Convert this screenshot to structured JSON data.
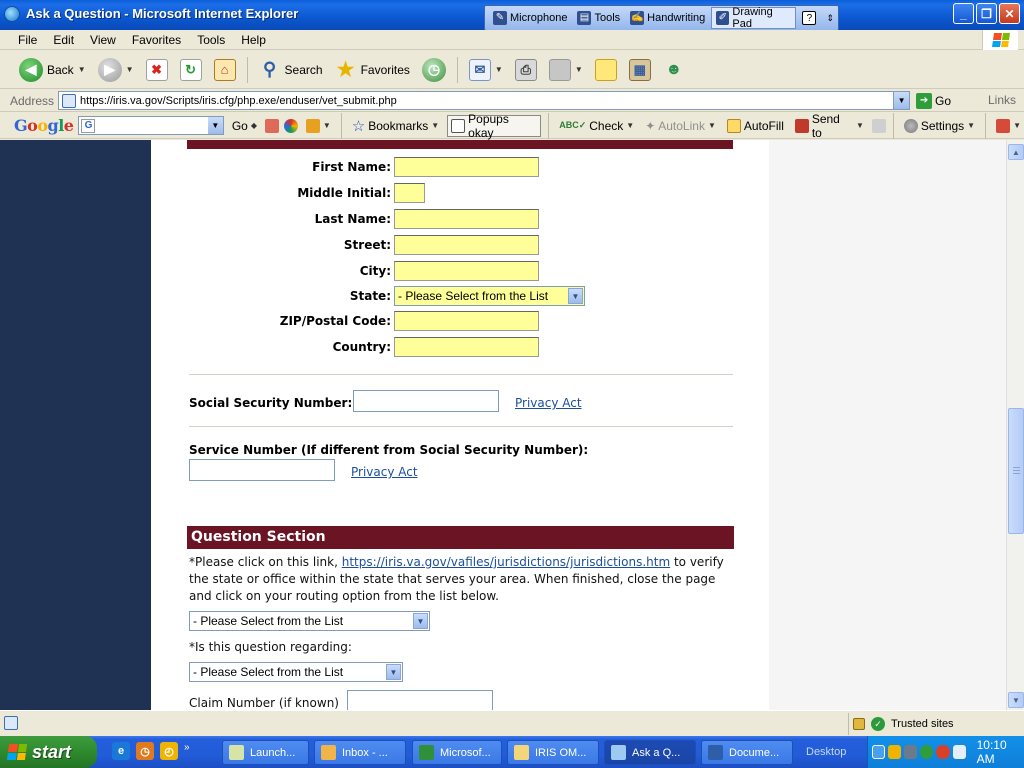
{
  "window": {
    "title": "Ask a Question - Microsoft Internet Explorer",
    "controls": {
      "minimize": "_",
      "maximize": "❐",
      "close": "✕"
    }
  },
  "language_bar": {
    "items": [
      "Microphone",
      "Tools",
      "Handwriting",
      "Drawing Pad"
    ],
    "help": "?"
  },
  "menu": [
    "File",
    "Edit",
    "View",
    "Favorites",
    "Tools",
    "Help"
  ],
  "toolbar": {
    "back": "Back",
    "search": "Search",
    "favorites": "Favorites"
  },
  "address": {
    "label": "Address",
    "url": "https://iris.va.gov/Scripts/iris.cfg/php.exe/enduser/vet_submit.php",
    "go": "Go",
    "links": "Links"
  },
  "google_toolbar": {
    "logo": "Google",
    "go": "Go",
    "bookmarks": "Bookmarks",
    "popups": "Popups okay",
    "check": "Check",
    "autolink": "AutoLink",
    "autofill": "AutoFill",
    "send_to": "Send to",
    "settings": "Settings"
  },
  "form": {
    "fields": [
      {
        "label": "First Name:"
      },
      {
        "label": "Middle Initial:"
      },
      {
        "label": "Last Name:"
      },
      {
        "label": "Street:"
      },
      {
        "label": "City:"
      },
      {
        "label": "State:",
        "value": "- Please Select from the List"
      },
      {
        "label": "ZIP/Postal Code:"
      },
      {
        "label": "Country:"
      }
    ],
    "ssn_label": "Social Security Number:",
    "privacy_act": "Privacy Act",
    "service_number_label": "Service Number (If different from Social Security Number):"
  },
  "question_section": {
    "title": "Question Section",
    "instruction_prefix": "*Please click on this link, ",
    "instruction_link": "https://iris.va.gov/vafiles/jurisdictions/jurisdictions.htm",
    "instruction_suffix": " to verify the state or office within the state that serves your area. When finished, close the page and click on your routing option from the list below.",
    "routing_select": "- Please Select from the List",
    "regarding_label": "*Is this question regarding:",
    "regarding_select": "- Please Select from the List",
    "claim_label": "Claim Number (if known)"
  },
  "status": {
    "zone": "Trusted sites"
  },
  "taskbar": {
    "start": "start",
    "tasks": [
      "Launch...",
      "Inbox - ...",
      "Microsof...",
      "IRIS OM...",
      "Ask a Q...",
      "Docume..."
    ],
    "desktop": "Desktop",
    "clock": "10:10 AM"
  },
  "colors": {
    "maroon": "#6b1423",
    "navy": "#1f3254",
    "field_yellow": "#ffff99",
    "link": "#1a4f9c"
  }
}
